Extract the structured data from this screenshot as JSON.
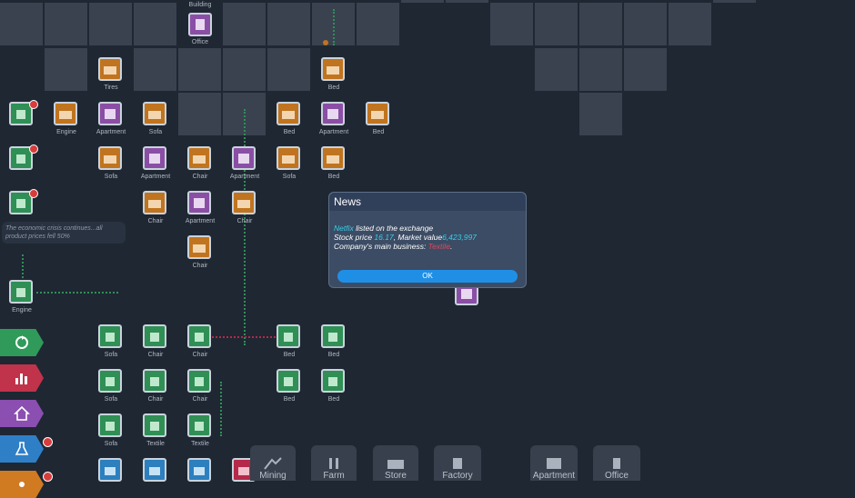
{
  "map_labels": {
    "building": "Building",
    "office": "Office",
    "tires": "Tires",
    "bed": "Bed",
    "engine": "Engine",
    "apartment": "Apartment",
    "sofa": "Sofa",
    "chair": "Chair",
    "textile": "Textile"
  },
  "crisis_notice": "The economic crisis continues...all product prices fell 50%",
  "news_dialog": {
    "title": "News",
    "company": "Netfix",
    "listed_text": " listed on the exchange",
    "stock_label": "Stock price ",
    "stock_price": "16.17",
    "market_label": ", Market value",
    "market_value": "6,423,997",
    "business_label": "Company's main business: ",
    "business_value": "Textile",
    "business_end": ".",
    "ok_label": "OK"
  },
  "bottom_bar": [
    {
      "label": "Mining",
      "icon": "mining-icon"
    },
    {
      "label": "Farm",
      "icon": "farm-icon"
    },
    {
      "label": "Store",
      "icon": "store-icon"
    },
    {
      "label": "Factory",
      "icon": "factory-icon"
    },
    {
      "label": "Apartment",
      "icon": "apartment-icon"
    },
    {
      "label": "Office",
      "icon": "office-icon"
    }
  ],
  "side_tabs": [
    {
      "icon": "recycle-icon",
      "color": "#2f9a5a"
    },
    {
      "icon": "bar-chart-icon",
      "color": "#c0334a"
    },
    {
      "icon": "home-icon",
      "color": "#8a4fb0"
    },
    {
      "icon": "flask-icon",
      "color": "#2f7fc7",
      "badge": "1"
    },
    {
      "icon": "more-icon",
      "color": "#d07a22",
      "badge": "1"
    }
  ],
  "colors": {
    "background": "#1f2733",
    "cell": "#3a4250",
    "orange": "#c0741f",
    "purple": "#8a4fa5",
    "green": "#2f8f55",
    "accent_cyan": "#35d0e8",
    "accent_red": "#e0475b",
    "ok_button": "#1f8fe6"
  }
}
